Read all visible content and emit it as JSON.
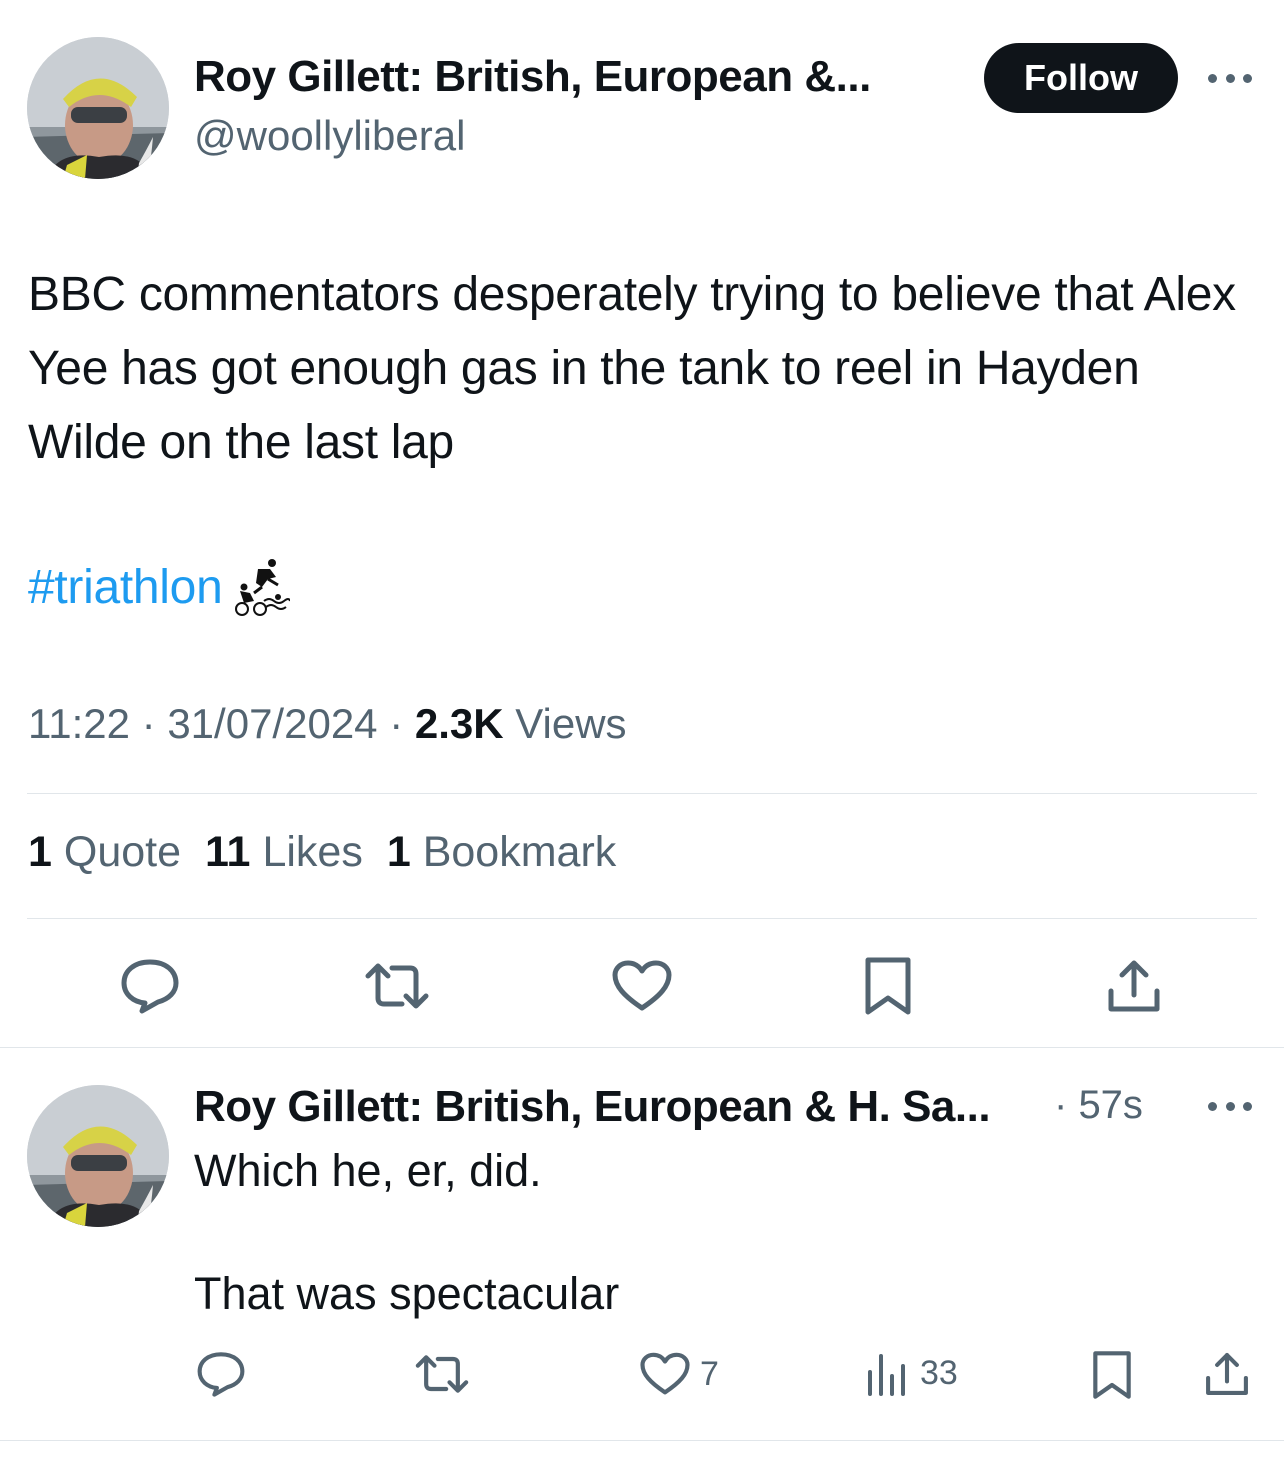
{
  "tweet": {
    "author_name": "Roy Gillett: British, European &...",
    "author_handle": "@woollyliberal",
    "follow_label": "Follow",
    "text": "BBC commentators desperately trying to believe that Alex Yee has got enough gas in the tank to reel in Hayden Wilde on the last lap",
    "hashtag": "#triathlon",
    "time": "11:22",
    "date": "31/07/2024",
    "views_count": "2.3K",
    "views_label": "Views",
    "stats": {
      "quotes_count": "1",
      "quotes_label": "Quote",
      "likes_count": "11",
      "likes_label": "Likes",
      "bookmarks_count": "1",
      "bookmarks_label": "Bookmark"
    },
    "actions": [
      "reply-icon",
      "retweet-icon",
      "like-icon",
      "bookmark-icon",
      "share-icon"
    ]
  },
  "reply": {
    "author_name": "Roy Gillett: British, European & H. Sa...",
    "time_ago": "57s",
    "line1": "Which he, er, did.",
    "line2": "That was spectacular",
    "likes_count": "7",
    "views_count": "33"
  },
  "colors": {
    "text": "#0f1419",
    "secondary": "#536471",
    "link": "#1d9bf0",
    "divider": "#e1e6ea"
  }
}
